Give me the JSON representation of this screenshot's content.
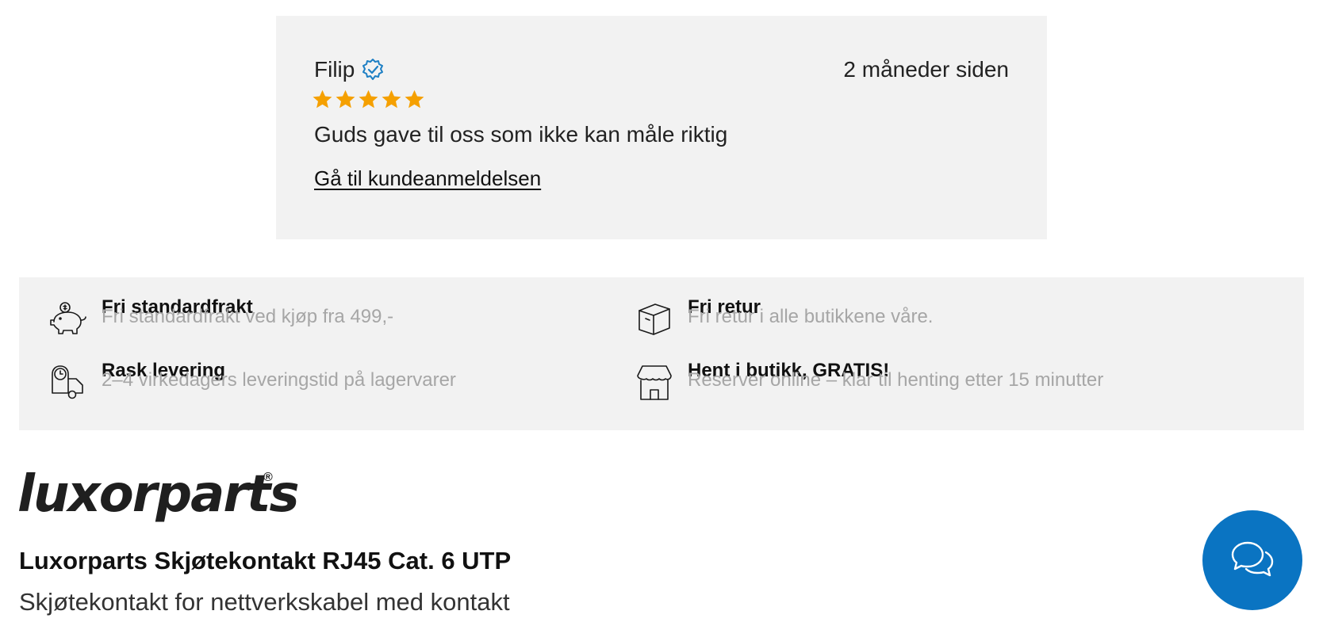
{
  "review": {
    "reviewer": "Filip",
    "date": "2 måneder siden",
    "rating": 5,
    "text": "Guds gave til oss som ikke kan måle riktig",
    "link_label": "Gå til kundeanmeldelsen"
  },
  "benefits": [
    {
      "icon": "piggy-bank-icon",
      "title": "Fri standardfrakt",
      "subtitle": "Fri standardfrakt ved kjøp fra 499,-"
    },
    {
      "icon": "box-icon",
      "title": "Fri retur",
      "subtitle": "Fri retur i alle butikkene våre."
    },
    {
      "icon": "delivery-truck-clock-icon",
      "title": "Rask levering",
      "subtitle": "2–4 virkedagers leveringstid på lagervarer"
    },
    {
      "icon": "storefront-icon",
      "title": "Hent i butikk, GRATIS!",
      "subtitle": "Reserver online – klar til henting etter 15 minutter"
    }
  ],
  "brand": {
    "logo_text": "luxorparts",
    "registered_mark": "®"
  },
  "product": {
    "title": "Luxorparts Skjøtekontakt RJ45 Cat. 6 UTP",
    "subtitle": "Skjøtekontakt for nettverkskabel med kontakt"
  },
  "colors": {
    "star": "#f5a000",
    "verified": "#1d7fc4",
    "chat": "#0a74c2"
  }
}
